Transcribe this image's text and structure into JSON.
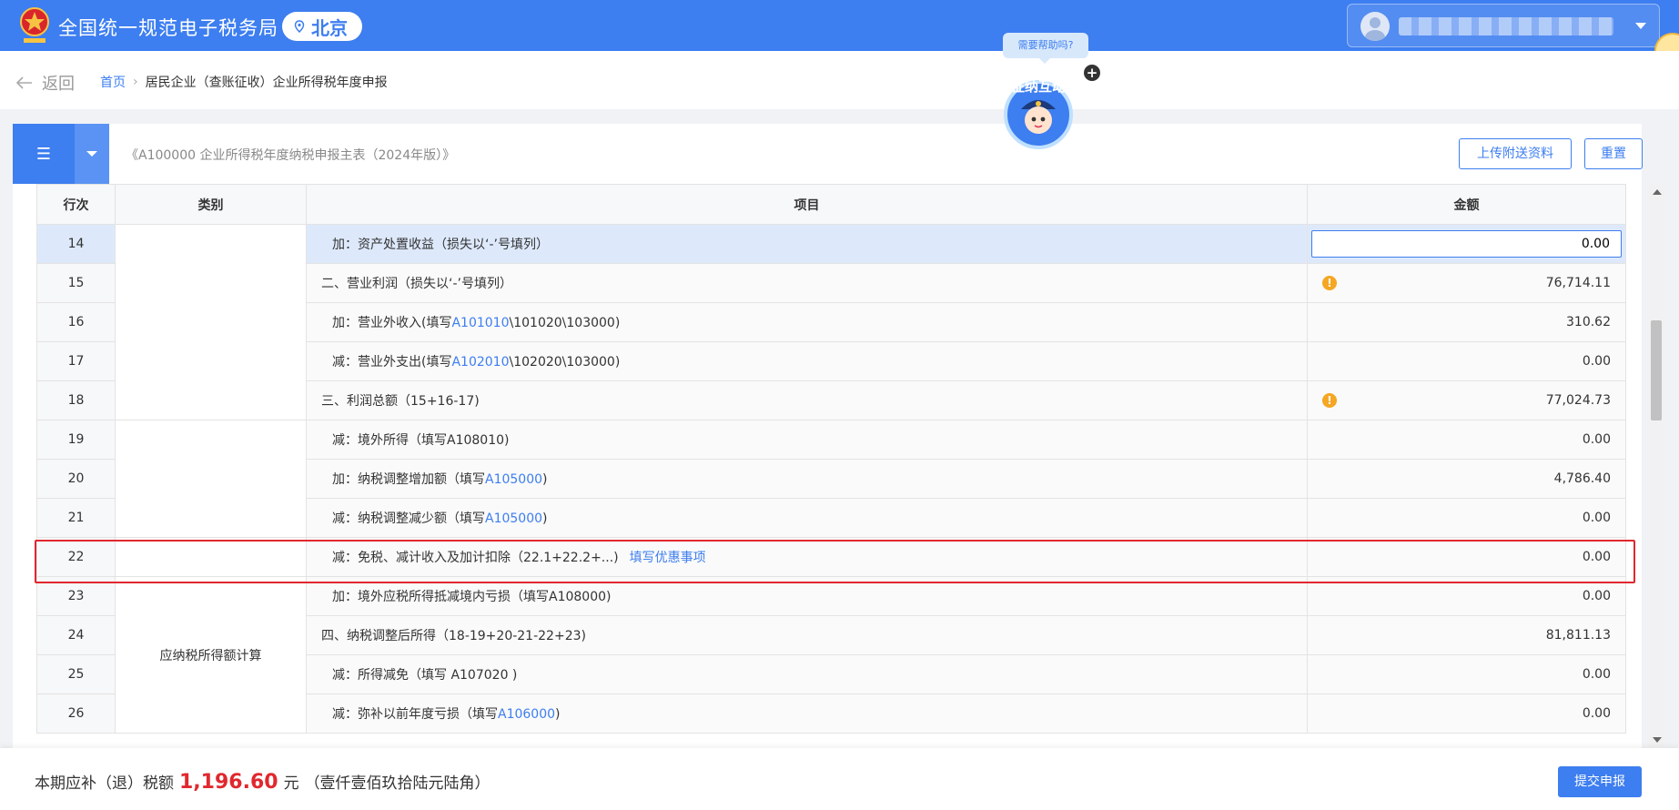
{
  "header": {
    "system_title": "全国统一规范电子税务局",
    "region": "北京",
    "user_name": ""
  },
  "breadcrumb": {
    "back_label": "返回",
    "home": "首页",
    "separator": "›",
    "current": "居民企业（查账征收）企业所得税年度申报"
  },
  "helper": {
    "bubble_text": "需要帮助吗?",
    "mascot_text": "征纳互动",
    "plus": "+"
  },
  "form": {
    "menu_icon": "☰",
    "title": "《A100000 企业所得税年度纳税申报主表（2024年版）》",
    "upload_button": "上传附送资料",
    "reset_button": "重置"
  },
  "table": {
    "headers": {
      "row": "行次",
      "category": "类别",
      "item": "项目",
      "amount": "金额"
    },
    "category_label": "应纳税所得额计算",
    "rows": [
      {
        "no": "14",
        "item_prefix": "加：资产处置收益（损失以‘-’号填列）",
        "link": "",
        "item_suffix": "",
        "amount": "0.00",
        "warn": false
      },
      {
        "no": "15",
        "item_prefix": "二、营业利润（损失以‘-’号填列）",
        "link": "",
        "item_suffix": "",
        "amount": "76,714.11",
        "warn": true
      },
      {
        "no": "16",
        "item_prefix": "加：营业外收入(填写",
        "link": "A101010",
        "item_suffix": "\\101020\\103000)",
        "amount": "310.62",
        "warn": false
      },
      {
        "no": "17",
        "item_prefix": "减：营业外支出(填写",
        "link": "A102010",
        "item_suffix": "\\102020\\103000)",
        "amount": "0.00",
        "warn": false
      },
      {
        "no": "18",
        "item_prefix": "三、利润总额（15+16-17)",
        "link": "",
        "item_suffix": "",
        "amount": "77,024.73",
        "warn": true
      },
      {
        "no": "19",
        "item_prefix": "减：境外所得（填写A108010)",
        "link": "",
        "item_suffix": "",
        "amount": "0.00",
        "warn": false
      },
      {
        "no": "20",
        "item_prefix": "加：纳税调整增加额（填写",
        "link": "A105000",
        "item_suffix": ")",
        "amount": "4,786.40",
        "warn": false
      },
      {
        "no": "21",
        "item_prefix": "减：纳税调整减少额（填写",
        "link": "A105000",
        "item_suffix": ")",
        "amount": "0.00",
        "warn": false
      },
      {
        "no": "22",
        "item_prefix": "减：免税、减计收入及加计扣除（22.1+22.2+...)",
        "link": "",
        "item_suffix": "",
        "discount_link": "填写优惠事项",
        "amount": "0.00",
        "warn": false
      },
      {
        "no": "23",
        "item_prefix": "加：境外应税所得抵减境内亏损（填写A108000)",
        "link": "",
        "item_suffix": "",
        "amount": "0.00",
        "warn": false
      },
      {
        "no": "24",
        "item_prefix": "四、纳税调整后所得（18-19+20-21-22+23)",
        "link": "",
        "item_suffix": "",
        "amount": "81,811.13",
        "warn": false
      },
      {
        "no": "25",
        "item_prefix": "减：所得减免（填写 A107020 )",
        "link": "",
        "item_suffix": "",
        "amount": "0.00",
        "warn": false
      },
      {
        "no": "26",
        "item_prefix": "减：弥补以前年度亏损（填写",
        "link": "A106000",
        "item_suffix": ")",
        "amount": "0.00",
        "warn": false
      }
    ]
  },
  "footer": {
    "label": "本期应补（退）税额",
    "amount": "1,196.60",
    "unit": "元",
    "amount_words": "（壹仟壹佰玖拾陆元陆角）",
    "submit_button": "提交申报"
  },
  "colors": {
    "primary": "#3d7ef0",
    "danger": "#e0282e",
    "warning": "#f5a623"
  }
}
